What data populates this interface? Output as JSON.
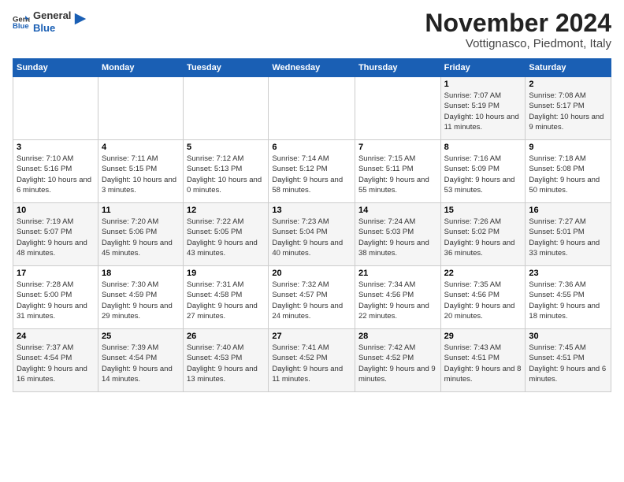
{
  "header": {
    "logo_line1": "General",
    "logo_line2": "Blue",
    "month_title": "November 2024",
    "subtitle": "Vottignasco, Piedmont, Italy"
  },
  "days_of_week": [
    "Sunday",
    "Monday",
    "Tuesday",
    "Wednesday",
    "Thursday",
    "Friday",
    "Saturday"
  ],
  "weeks": [
    [
      {
        "day": "",
        "info": ""
      },
      {
        "day": "",
        "info": ""
      },
      {
        "day": "",
        "info": ""
      },
      {
        "day": "",
        "info": ""
      },
      {
        "day": "",
        "info": ""
      },
      {
        "day": "1",
        "info": "Sunrise: 7:07 AM\nSunset: 5:19 PM\nDaylight: 10 hours and 11 minutes."
      },
      {
        "day": "2",
        "info": "Sunrise: 7:08 AM\nSunset: 5:17 PM\nDaylight: 10 hours and 9 minutes."
      }
    ],
    [
      {
        "day": "3",
        "info": "Sunrise: 7:10 AM\nSunset: 5:16 PM\nDaylight: 10 hours and 6 minutes."
      },
      {
        "day": "4",
        "info": "Sunrise: 7:11 AM\nSunset: 5:15 PM\nDaylight: 10 hours and 3 minutes."
      },
      {
        "day": "5",
        "info": "Sunrise: 7:12 AM\nSunset: 5:13 PM\nDaylight: 10 hours and 0 minutes."
      },
      {
        "day": "6",
        "info": "Sunrise: 7:14 AM\nSunset: 5:12 PM\nDaylight: 9 hours and 58 minutes."
      },
      {
        "day": "7",
        "info": "Sunrise: 7:15 AM\nSunset: 5:11 PM\nDaylight: 9 hours and 55 minutes."
      },
      {
        "day": "8",
        "info": "Sunrise: 7:16 AM\nSunset: 5:09 PM\nDaylight: 9 hours and 53 minutes."
      },
      {
        "day": "9",
        "info": "Sunrise: 7:18 AM\nSunset: 5:08 PM\nDaylight: 9 hours and 50 minutes."
      }
    ],
    [
      {
        "day": "10",
        "info": "Sunrise: 7:19 AM\nSunset: 5:07 PM\nDaylight: 9 hours and 48 minutes."
      },
      {
        "day": "11",
        "info": "Sunrise: 7:20 AM\nSunset: 5:06 PM\nDaylight: 9 hours and 45 minutes."
      },
      {
        "day": "12",
        "info": "Sunrise: 7:22 AM\nSunset: 5:05 PM\nDaylight: 9 hours and 43 minutes."
      },
      {
        "day": "13",
        "info": "Sunrise: 7:23 AM\nSunset: 5:04 PM\nDaylight: 9 hours and 40 minutes."
      },
      {
        "day": "14",
        "info": "Sunrise: 7:24 AM\nSunset: 5:03 PM\nDaylight: 9 hours and 38 minutes."
      },
      {
        "day": "15",
        "info": "Sunrise: 7:26 AM\nSunset: 5:02 PM\nDaylight: 9 hours and 36 minutes."
      },
      {
        "day": "16",
        "info": "Sunrise: 7:27 AM\nSunset: 5:01 PM\nDaylight: 9 hours and 33 minutes."
      }
    ],
    [
      {
        "day": "17",
        "info": "Sunrise: 7:28 AM\nSunset: 5:00 PM\nDaylight: 9 hours and 31 minutes."
      },
      {
        "day": "18",
        "info": "Sunrise: 7:30 AM\nSunset: 4:59 PM\nDaylight: 9 hours and 29 minutes."
      },
      {
        "day": "19",
        "info": "Sunrise: 7:31 AM\nSunset: 4:58 PM\nDaylight: 9 hours and 27 minutes."
      },
      {
        "day": "20",
        "info": "Sunrise: 7:32 AM\nSunset: 4:57 PM\nDaylight: 9 hours and 24 minutes."
      },
      {
        "day": "21",
        "info": "Sunrise: 7:34 AM\nSunset: 4:56 PM\nDaylight: 9 hours and 22 minutes."
      },
      {
        "day": "22",
        "info": "Sunrise: 7:35 AM\nSunset: 4:56 PM\nDaylight: 9 hours and 20 minutes."
      },
      {
        "day": "23",
        "info": "Sunrise: 7:36 AM\nSunset: 4:55 PM\nDaylight: 9 hours and 18 minutes."
      }
    ],
    [
      {
        "day": "24",
        "info": "Sunrise: 7:37 AM\nSunset: 4:54 PM\nDaylight: 9 hours and 16 minutes."
      },
      {
        "day": "25",
        "info": "Sunrise: 7:39 AM\nSunset: 4:54 PM\nDaylight: 9 hours and 14 minutes."
      },
      {
        "day": "26",
        "info": "Sunrise: 7:40 AM\nSunset: 4:53 PM\nDaylight: 9 hours and 13 minutes."
      },
      {
        "day": "27",
        "info": "Sunrise: 7:41 AM\nSunset: 4:52 PM\nDaylight: 9 hours and 11 minutes."
      },
      {
        "day": "28",
        "info": "Sunrise: 7:42 AM\nSunset: 4:52 PM\nDaylight: 9 hours and 9 minutes."
      },
      {
        "day": "29",
        "info": "Sunrise: 7:43 AM\nSunset: 4:51 PM\nDaylight: 9 hours and 8 minutes."
      },
      {
        "day": "30",
        "info": "Sunrise: 7:45 AM\nSunset: 4:51 PM\nDaylight: 9 hours and 6 minutes."
      }
    ]
  ]
}
